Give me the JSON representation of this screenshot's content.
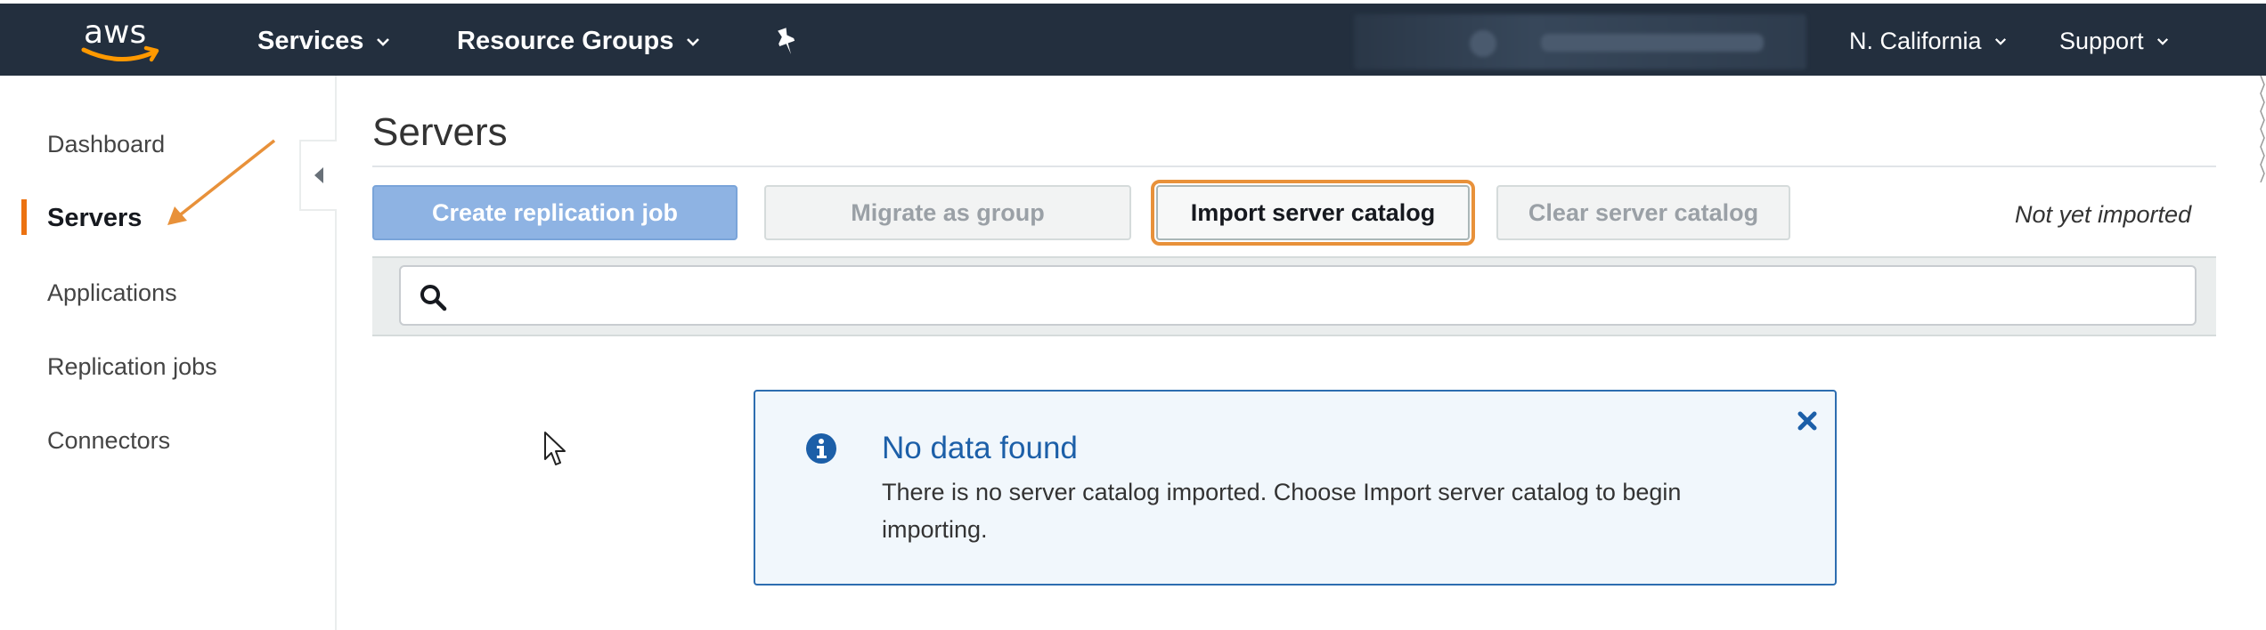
{
  "topnav": {
    "logo_text": "aws",
    "services_label": "Services",
    "resource_groups_label": "Resource Groups",
    "region_label": "N. California",
    "support_label": "Support",
    "background_color": "#232f3e",
    "logo_smile_color": "#ff9900"
  },
  "sidebar": {
    "items": [
      {
        "label": "Dashboard",
        "active": false
      },
      {
        "label": "Servers",
        "active": true
      },
      {
        "label": "Applications",
        "active": false
      },
      {
        "label": "Replication jobs",
        "active": false
      },
      {
        "label": "Connectors",
        "active": false
      }
    ],
    "active_marker_color": "#ec7211"
  },
  "main": {
    "page_title": "Servers",
    "toolbar": {
      "create_replication_job_label": "Create replication job",
      "migrate_as_group_label": "Migrate as group",
      "import_server_catalog_label": "Import server catalog",
      "clear_server_catalog_label": "Clear server catalog",
      "status_text": "Not yet imported"
    },
    "search": {
      "value": "",
      "placeholder": ""
    },
    "alert": {
      "title": "No data found",
      "body": "There is no server catalog imported. Choose Import server catalog to begin importing."
    }
  },
  "annotations": {
    "highlight_color": "#e8913a"
  }
}
